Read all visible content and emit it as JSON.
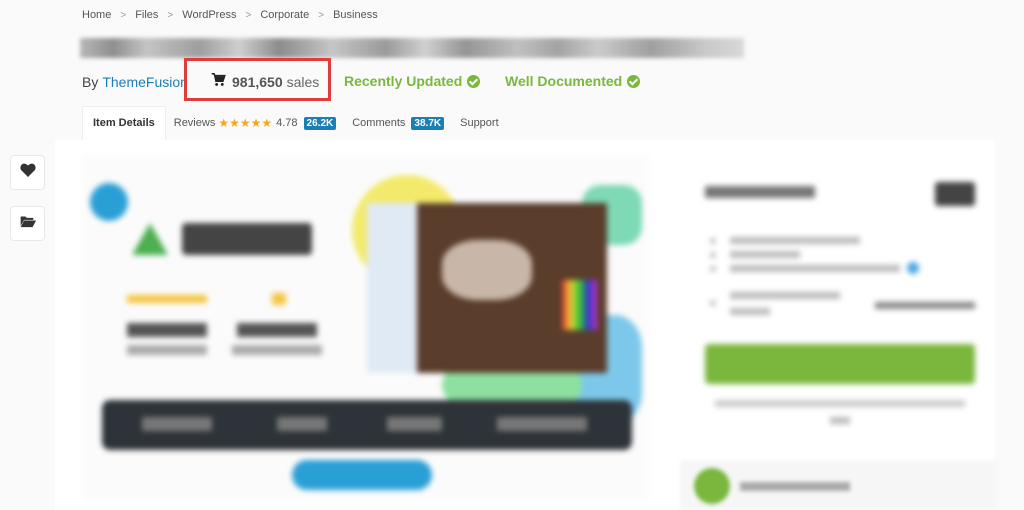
{
  "breadcrumb": {
    "items": [
      "Home",
      "Files",
      "WordPress",
      "Corporate",
      "Business"
    ],
    "separator": ">"
  },
  "item": {
    "title_blurred": true,
    "by_label": "By",
    "author": "ThemeFusion",
    "sales_count": "981,650",
    "sales_label": "sales",
    "badges": [
      {
        "label": "Recently Updated",
        "icon": "check-circle-icon"
      },
      {
        "label": "Well Documented",
        "icon": "check-circle-icon"
      }
    ]
  },
  "tabs": {
    "item_details": "Item Details",
    "reviews": "Reviews",
    "rating_stars": "★★★★★",
    "rating_value": "4.78",
    "reviews_count": "26.2K",
    "comments": "Comments",
    "comments_count": "38.7K",
    "support": "Support"
  },
  "side_actions": [
    {
      "name": "favorite",
      "icon": "heart-icon"
    },
    {
      "name": "collection",
      "icon": "folder-open-icon"
    }
  ],
  "colors": {
    "link": "#1a7fb5",
    "green": "#7ab73c",
    "highlight": "#e03c3c",
    "star": "#f5a623",
    "count_badge": "#1a7fb5"
  }
}
